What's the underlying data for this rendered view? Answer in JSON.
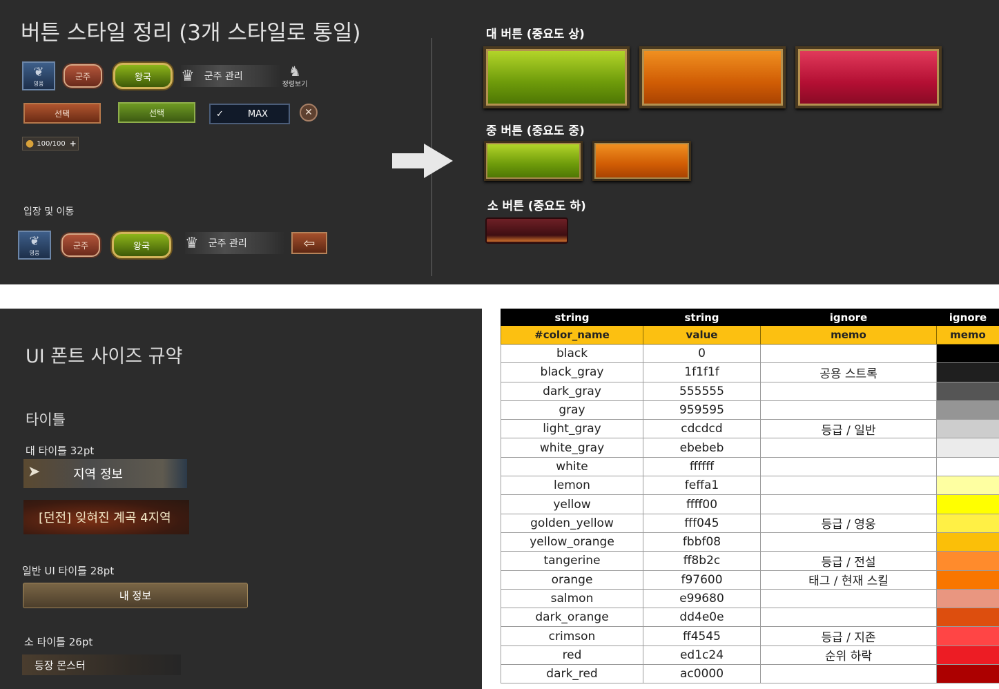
{
  "top": {
    "title": "버튼 스타일 정리 (3개 스타일로 통일)",
    "row1": {
      "hero_label": "영웅",
      "lord_small_label": "군주",
      "kingdom_label": "왕국",
      "lord_manage_label": "군주 관리",
      "lookup_label": "정령보기"
    },
    "row2": {
      "select_brown_label": "선택",
      "select_green_label": "선택",
      "max_label": "MAX",
      "close_glyph": "✕"
    },
    "counter": {
      "value_text": "100/100",
      "plus_glyph": "+"
    },
    "entry_section_label": "입장 및 이동",
    "row3": {
      "hero_label": "영웅",
      "lord_small_label": "군주",
      "kingdom_label": "왕국",
      "lord_manage_label": "군주 관리",
      "back_glyph": "⇦"
    },
    "big_section_label": "대 버튼 (중요도 상)",
    "mid_section_label": "중 버튼 (중요도 중)",
    "small_section_label": "소 버튼 (중요도 하)",
    "icons": {
      "hero": "wing-emblem-icon",
      "crown": "crown-icon",
      "lookup": "horse-spirit-icon",
      "check": "check-icon",
      "close": "close-icon",
      "drop": "drop-icon",
      "back": "back-arrow-icon",
      "arrow": "right-arrow-icon"
    }
  },
  "fonts": {
    "title": "UI 폰트 사이즈 규약",
    "category": "타이틀",
    "large_label": "대 타이틀 32pt",
    "region_banner": "지역 정보",
    "dungeon_banner": "[던전] 잊혀진 계곡 4지역",
    "normal_label": "일반 UI 타이틀 28pt",
    "info_banner": "내 정보",
    "small_label": "소 타이틀 26pt",
    "monster_banner": "등장 몬스터"
  },
  "table": {
    "type_row": [
      "string",
      "string",
      "ignore",
      "ignore"
    ],
    "header_row": [
      "#color_name",
      "value",
      "memo",
      "memo"
    ],
    "rows": [
      {
        "name": "black",
        "value": "0",
        "memo": "",
        "hex": "#000000"
      },
      {
        "name": "black_gray",
        "value": "1f1f1f",
        "memo": "공용 스트록",
        "hex": "#1f1f1f"
      },
      {
        "name": "dark_gray",
        "value": "555555",
        "memo": "",
        "hex": "#555555"
      },
      {
        "name": "gray",
        "value": "959595",
        "memo": "",
        "hex": "#959595"
      },
      {
        "name": "light_gray",
        "value": "cdcdcd",
        "memo": "등급 / 일반",
        "hex": "#cdcdcd"
      },
      {
        "name": "white_gray",
        "value": "ebebeb",
        "memo": "",
        "hex": "#ebebeb"
      },
      {
        "name": "white",
        "value": "ffffff",
        "memo": "",
        "hex": "#ffffff"
      },
      {
        "name": "lemon",
        "value": "feffa1",
        "memo": "",
        "hex": "#feffa1"
      },
      {
        "name": "yellow",
        "value": "ffff00",
        "memo": "",
        "hex": "#ffff00"
      },
      {
        "name": "golden_yellow",
        "value": "fff045",
        "memo": "등급 / 영웅",
        "hex": "#fff045"
      },
      {
        "name": "yellow_orange",
        "value": "fbbf08",
        "memo": "",
        "hex": "#fbbf08"
      },
      {
        "name": "tangerine",
        "value": "ff8b2c",
        "memo": "등급 / 전설",
        "hex": "#ff8b2c"
      },
      {
        "name": "orange",
        "value": "f97600",
        "memo": "태그 / 현재 스킬",
        "hex": "#f97600"
      },
      {
        "name": "salmon",
        "value": "e99680",
        "memo": "",
        "hex": "#e99680"
      },
      {
        "name": "dark_orange",
        "value": "dd4e0e",
        "memo": "",
        "hex": "#dd4e0e"
      },
      {
        "name": "crimson",
        "value": "ff4545",
        "memo": "등급 / 지존",
        "hex": "#ff4545"
      },
      {
        "name": "red",
        "value": "ed1c24",
        "memo": "순위 하락",
        "hex": "#ed1c24"
      },
      {
        "name": "dark_red",
        "value": "ac0000",
        "memo": "",
        "hex": "#ac0000"
      }
    ]
  }
}
